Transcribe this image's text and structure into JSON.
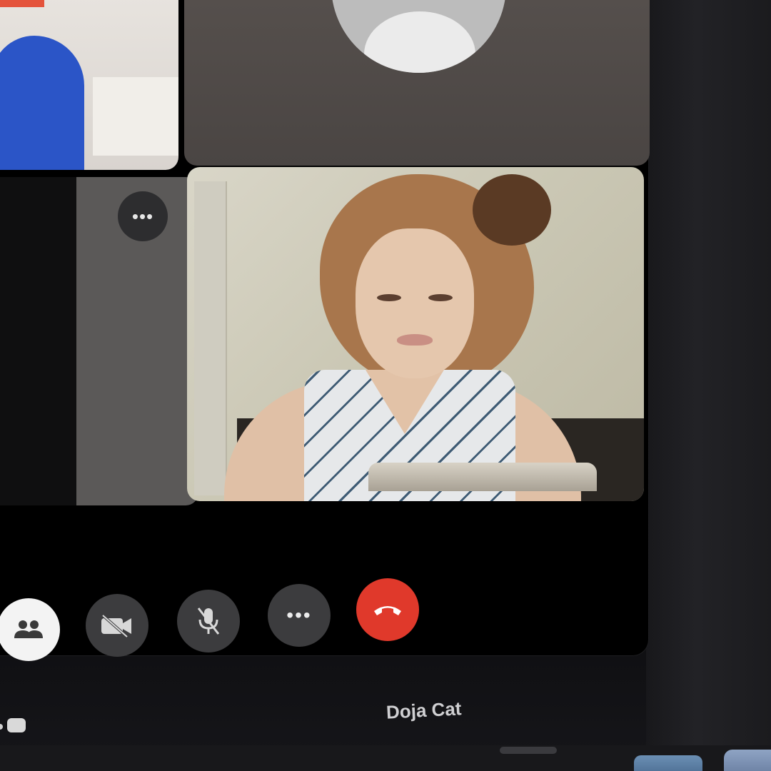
{
  "call": {
    "participant_name": "Doja Cat",
    "tiles": [
      {
        "id": "top-left",
        "kind": "video"
      },
      {
        "id": "top-center",
        "kind": "avatar-placeholder"
      },
      {
        "id": "middle-left",
        "kind": "video",
        "more_label": "•••"
      },
      {
        "id": "main",
        "kind": "video"
      }
    ]
  },
  "controls": {
    "participants_icon": "people-icon",
    "video_icon": "video-off-icon",
    "mic_icon": "mic-off-icon",
    "more_label": "•••",
    "end_call_icon": "phone-hangup-icon"
  },
  "colors": {
    "end_call": "#e0392b",
    "control_bg": "#3c3c3e",
    "participants_bg": "#f3f3f3",
    "window_bg": "#000000"
  }
}
